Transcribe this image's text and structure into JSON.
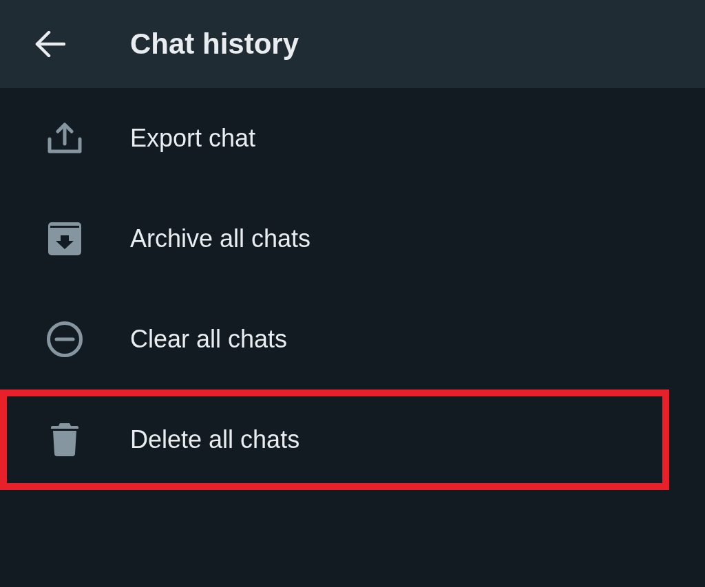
{
  "header": {
    "title": "Chat history"
  },
  "items": [
    {
      "label": "Export chat",
      "highlighted": false
    },
    {
      "label": "Archive all chats",
      "highlighted": false
    },
    {
      "label": "Clear all chats",
      "highlighted": false
    },
    {
      "label": "Delete all chats",
      "highlighted": true
    }
  ]
}
